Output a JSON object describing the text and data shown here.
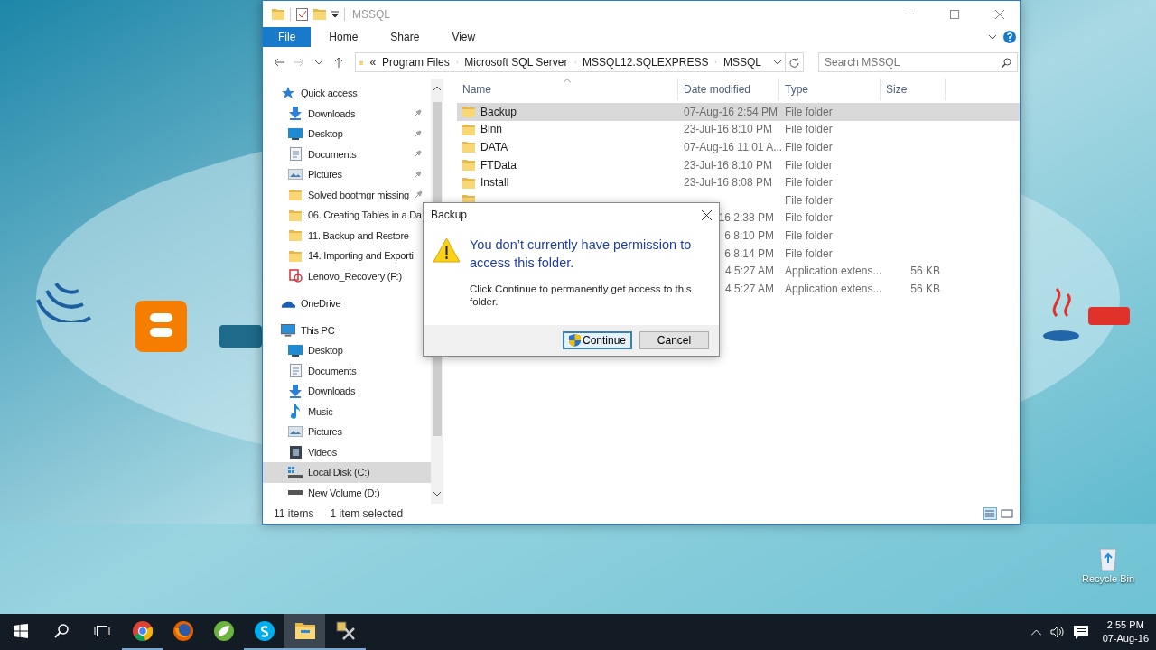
{
  "window": {
    "title": "MSSQL"
  },
  "ribbon_tabs": [
    {
      "label": "File",
      "kind": "file"
    },
    {
      "label": "Home",
      "kind": "tab"
    },
    {
      "label": "Share",
      "kind": "tab"
    },
    {
      "label": "View",
      "kind": "tab"
    }
  ],
  "address_bar": {
    "overflow": "«",
    "segments": [
      "Program Files",
      "Microsoft SQL Server",
      "MSSQL12.SQLEXPRESS",
      "MSSQL"
    ]
  },
  "search": {
    "placeholder": "Search MSSQL"
  },
  "sidebar": {
    "items": [
      {
        "label": "Quick access",
        "kind": "star",
        "children": [
          {
            "label": "Downloads",
            "kind": "download",
            "pinned": true,
            "selected": false
          },
          {
            "label": "Desktop",
            "kind": "desktop",
            "pinned": true,
            "selected": false
          },
          {
            "label": "Documents",
            "kind": "document",
            "pinned": true,
            "selected": false
          },
          {
            "label": "Pictures",
            "kind": "pictures",
            "pinned": true,
            "selected": false
          },
          {
            "label": "Solved bootmgr missing",
            "kind": "folder",
            "pinned": true,
            "selected": false
          },
          {
            "label": "06. Creating Tables in a Da",
            "kind": "folder",
            "pinned": false,
            "selected": false
          },
          {
            "label": "11. Backup and Restore",
            "kind": "folder",
            "pinned": false,
            "selected": false
          },
          {
            "label": "14. Importing and Exporti",
            "kind": "folder",
            "pinned": false,
            "selected": false
          },
          {
            "label": "Lenovo_Recovery (F:)",
            "kind": "recovery",
            "pinned": false,
            "selected": false
          }
        ],
        "selected": false
      },
      {
        "label": "OneDrive",
        "kind": "cloud",
        "selected": false
      },
      {
        "label": "This PC",
        "kind": "pc",
        "children": [
          {
            "label": "Desktop",
            "kind": "desktop",
            "selected": false
          },
          {
            "label": "Documents",
            "kind": "document",
            "selected": false
          },
          {
            "label": "Downloads",
            "kind": "download",
            "selected": false
          },
          {
            "label": "Music",
            "kind": "music",
            "selected": false
          },
          {
            "label": "Pictures",
            "kind": "pictures",
            "selected": false
          },
          {
            "label": "Videos",
            "kind": "videos",
            "selected": false
          },
          {
            "label": "Local Disk (C:)",
            "kind": "disk",
            "selected": true
          },
          {
            "label": "New Volume (D:)",
            "kind": "drive",
            "selected": false
          }
        ],
        "selected": false
      }
    ]
  },
  "table": {
    "columns": [
      "Name",
      "Date modified",
      "Type",
      "Size"
    ],
    "rows": [
      {
        "kind": "folder",
        "name": "Backup",
        "date": "07-Aug-16 2:54 PM",
        "type": "File folder",
        "selected": true
      },
      {
        "kind": "folder",
        "name": "Binn",
        "date": "23-Jul-16 8:10 PM",
        "type": "File folder",
        "selected": false
      },
      {
        "kind": "folder",
        "name": "DATA",
        "date": "07-Aug-16 11:01 A...",
        "type": "File folder",
        "selected": false
      },
      {
        "kind": "folder",
        "name": "FTData",
        "date": "23-Jul-16 8:10 PM",
        "type": "File folder",
        "selected": false
      },
      {
        "kind": "folder",
        "name": "Install",
        "date": "23-Jul-16 8:08 PM",
        "type": "File folder",
        "selected": false
      },
      {
        "kind": "covered",
        "type": "File folder",
        "selected": false
      },
      {
        "kind": "clipped",
        "date": "16 2:38 PM",
        "type": "File folder",
        "selected": false
      },
      {
        "kind": "clipped",
        "date": "6 8:10 PM",
        "type": "File folder",
        "selected": false
      },
      {
        "kind": "clipped",
        "date": "6 8:14 PM",
        "type": "File folder",
        "selected": false
      },
      {
        "kind": "clipped",
        "date": "4 5:27 AM",
        "type": "Application extens...",
        "size": "56 KB",
        "selected": false
      },
      {
        "kind": "clipped",
        "date": "4 5:27 AM",
        "type": "Application extens...",
        "size": "56 KB",
        "selected": false
      }
    ]
  },
  "status_bar": {
    "item_count": "11 items",
    "selection": "1 item selected"
  },
  "dialog": {
    "title": "Backup",
    "heading": "You don’t currently have permission to access this folder.",
    "message": "Click Continue to permanently get access to this folder.",
    "buttons": [
      {
        "label": "Continue",
        "kind": "shield",
        "default": true
      },
      {
        "label": "Cancel",
        "kind": "plain",
        "default": false
      }
    ]
  },
  "desktop_icons": [
    {
      "label": "Recycle Bin"
    }
  ],
  "taskbar": {
    "apps": [
      {
        "kind": "chrome",
        "running": true,
        "selected": false
      },
      {
        "kind": "firefox",
        "running": false,
        "selected": false
      },
      {
        "kind": "leaf",
        "running": false,
        "selected": false
      },
      {
        "kind": "skype",
        "running": true,
        "selected": false
      },
      {
        "kind": "explorer",
        "running": true,
        "selected": true
      },
      {
        "kind": "tool",
        "running": true,
        "selected": false
      }
    ],
    "clock": {
      "time": "2:55 PM",
      "date": "07-Aug-16"
    }
  }
}
